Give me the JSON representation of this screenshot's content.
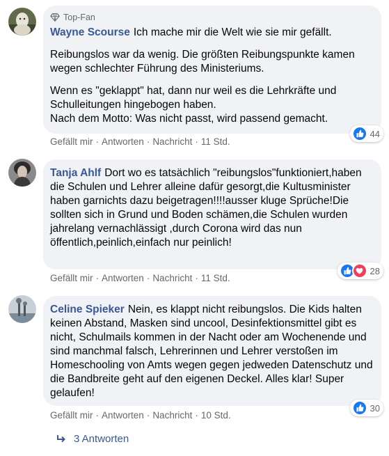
{
  "comments": [
    {
      "badge": "Top-Fan",
      "author": "Wayne Scourse",
      "paragraphs": [
        "Ich mache mir die Welt wie sie mir gefällt.",
        "Reibungslos war da wenig. Die größten Reibungspunkte kamen wegen schlechter Führung des Ministeriums.",
        "Wenn es \"geklappt\" hat, dann nur weil es die Lehrkräfte und Schulleitungen hingebogen haben.\nNach dem Motto: Was nicht passt, wird passend gemacht."
      ],
      "reaction_count": "44",
      "actions": {
        "like": "Gefällt mir",
        "reply": "Antworten",
        "message": "Nachricht",
        "time": "11 Std."
      }
    },
    {
      "author": "Tanja Ahlf",
      "paragraphs": [
        "Dort wo es tatsächlich \"reibungslos\"funktioniert,haben die Schulen und Lehrer alleine dafür gesorgt,die Kultusminister haben garnichts dazu beigetragen!!!!ausser kluge Sprüche!Die sollten sich in Grund und Boden schämen,die Schulen wurden jahrelang vernachlässigt ,durch Corona wird das nun öffentlich,peinlich,einfach nur peinlich!"
      ],
      "reaction_count": "28",
      "actions": {
        "like": "Gefällt mir",
        "reply": "Antworten",
        "message": "Nachricht",
        "time": "11 Std."
      }
    },
    {
      "author": "Celine Spieker",
      "paragraphs": [
        "Nein, es klappt nicht reibungslos. Die Kids halten keinen Abstand, Masken sind uncool, Desinfektionsmittel gibt es nicht, Schulmails kommen in der Nacht oder am Wochenende und sind manchmal falsch, Lehrerinnen und Lehrer verstoßen im Homeschooling von Amts wegen gegen jedweden Datenschutz und die Bandbreite geht auf den eigenen Deckel. Alles klar! Super gelaufen!"
      ],
      "reaction_count": "30",
      "actions": {
        "like": "Gefällt mir",
        "reply": "Antworten",
        "message": "Nachricht",
        "time": "10 Std."
      }
    }
  ],
  "replies_label": "3 Antworten",
  "colors": {
    "link": "#385898",
    "bubble": "#f0f2f5",
    "like": "#1877f2",
    "love": "#f33e58",
    "meta": "#65676b"
  }
}
